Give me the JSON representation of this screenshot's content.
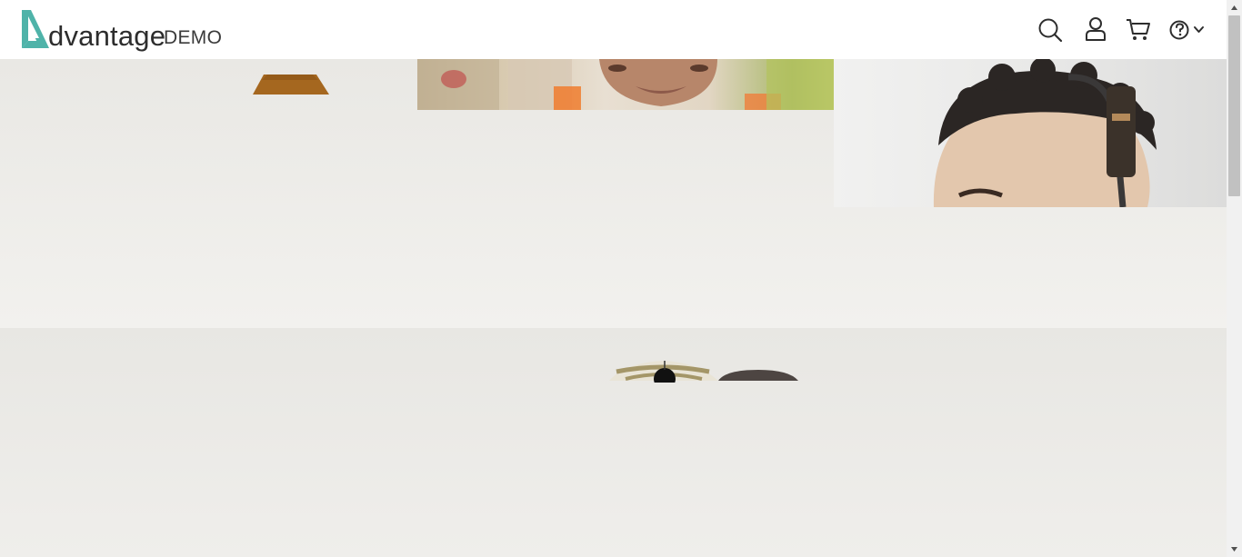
{
  "header": {
    "logo_text": "dvantage",
    "logo_sub": "DEMO",
    "icons": [
      "search-icon",
      "user-icon",
      "cart-icon",
      "help-icon",
      "chevron-down-icon"
    ]
  },
  "colors": {
    "brand_teal": "#4fb3a9",
    "text_dark": "#2d2d2d",
    "band_top": "#ecebe7",
    "band_bottom": "#ebeae6"
  },
  "content": {
    "tiles": [
      "speaker-image",
      "woman-image",
      "headphones-man-image",
      "mouse-image"
    ]
  }
}
